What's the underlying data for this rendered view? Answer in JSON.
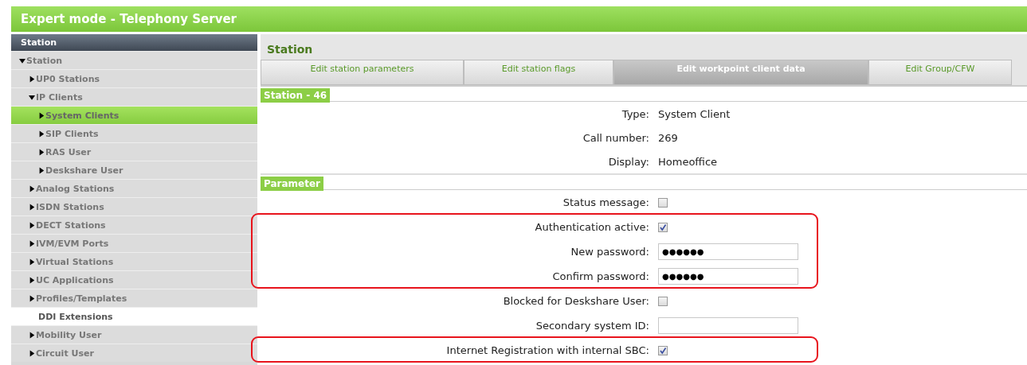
{
  "window": {
    "title": "Expert mode - Telephony Server"
  },
  "sidebar": {
    "header": "Station",
    "items": [
      {
        "label": "Station",
        "expanded": true,
        "selected": false,
        "hovered": false,
        "children": [
          {
            "label": "UP0 Stations",
            "expanded": false,
            "selected": false,
            "hovered": false
          },
          {
            "label": "IP Clients",
            "expanded": true,
            "selected": false,
            "hovered": false,
            "children": [
              {
                "label": "System Clients",
                "expanded": false,
                "selected": true,
                "hovered": false
              },
              {
                "label": "SIP Clients",
                "expanded": false,
                "selected": false,
                "hovered": false
              },
              {
                "label": "RAS User",
                "expanded": false,
                "selected": false,
                "hovered": false
              },
              {
                "label": "Deskshare User",
                "expanded": false,
                "selected": false,
                "hovered": false
              }
            ]
          },
          {
            "label": "Analog Stations",
            "expanded": false,
            "selected": false,
            "hovered": false
          },
          {
            "label": "ISDN Stations",
            "expanded": false,
            "selected": false,
            "hovered": false
          },
          {
            "label": "DECT Stations",
            "expanded": false,
            "selected": false,
            "hovered": false
          },
          {
            "label": "IVM/EVM Ports",
            "expanded": false,
            "selected": false,
            "hovered": false
          },
          {
            "label": "Virtual Stations",
            "expanded": false,
            "selected": false,
            "hovered": false
          },
          {
            "label": "UC Applications",
            "expanded": false,
            "selected": false,
            "hovered": false
          },
          {
            "label": "Profiles/Templates",
            "expanded": false,
            "selected": false,
            "hovered": false
          },
          {
            "label": "DDI Extensions",
            "kind": "leaf",
            "selected": false,
            "hovered": true
          },
          {
            "label": "Mobility User",
            "expanded": false,
            "selected": false,
            "hovered": false
          },
          {
            "label": "Circuit User",
            "expanded": false,
            "selected": false,
            "hovered": false
          }
        ]
      }
    ]
  },
  "content": {
    "title": "Station",
    "tabs": [
      {
        "label": "Edit station parameters",
        "selected": false
      },
      {
        "label": "Edit station flags",
        "selected": false
      },
      {
        "label": "Edit workpoint client data",
        "selected": true
      },
      {
        "label": "Edit Group/CFW",
        "selected": false
      }
    ],
    "sections": [
      {
        "title": "Station - 46",
        "rows": [
          {
            "kind": "text",
            "label": "Type:",
            "value": "System Client",
            "highlighted": false
          },
          {
            "kind": "text",
            "label": "Call number:",
            "value": "269",
            "highlighted": false
          },
          {
            "kind": "text",
            "label": "Display:",
            "value": "Homeoffice",
            "highlighted": false
          }
        ]
      },
      {
        "title": "Parameter",
        "rows": [
          {
            "kind": "checkbox",
            "label": "Status message:",
            "checked": false,
            "highlighted": false
          },
          {
            "kind": "checkbox",
            "label": "Authentication active:",
            "checked": true,
            "highlighted": true
          },
          {
            "kind": "password",
            "label": "New password:",
            "value": "●●●●●●",
            "highlighted": true
          },
          {
            "kind": "password",
            "label": "Confirm password:",
            "value": "●●●●●●",
            "highlighted": true
          },
          {
            "kind": "checkbox",
            "label": "Blocked for Deskshare User:",
            "checked": false,
            "highlighted": false
          },
          {
            "kind": "input",
            "label": "Secondary system ID:",
            "highlighted": false
          },
          {
            "kind": "checkbox",
            "label": "Internet Registration with internal SBC:",
            "checked": true,
            "highlighted": true
          }
        ]
      }
    ]
  }
}
